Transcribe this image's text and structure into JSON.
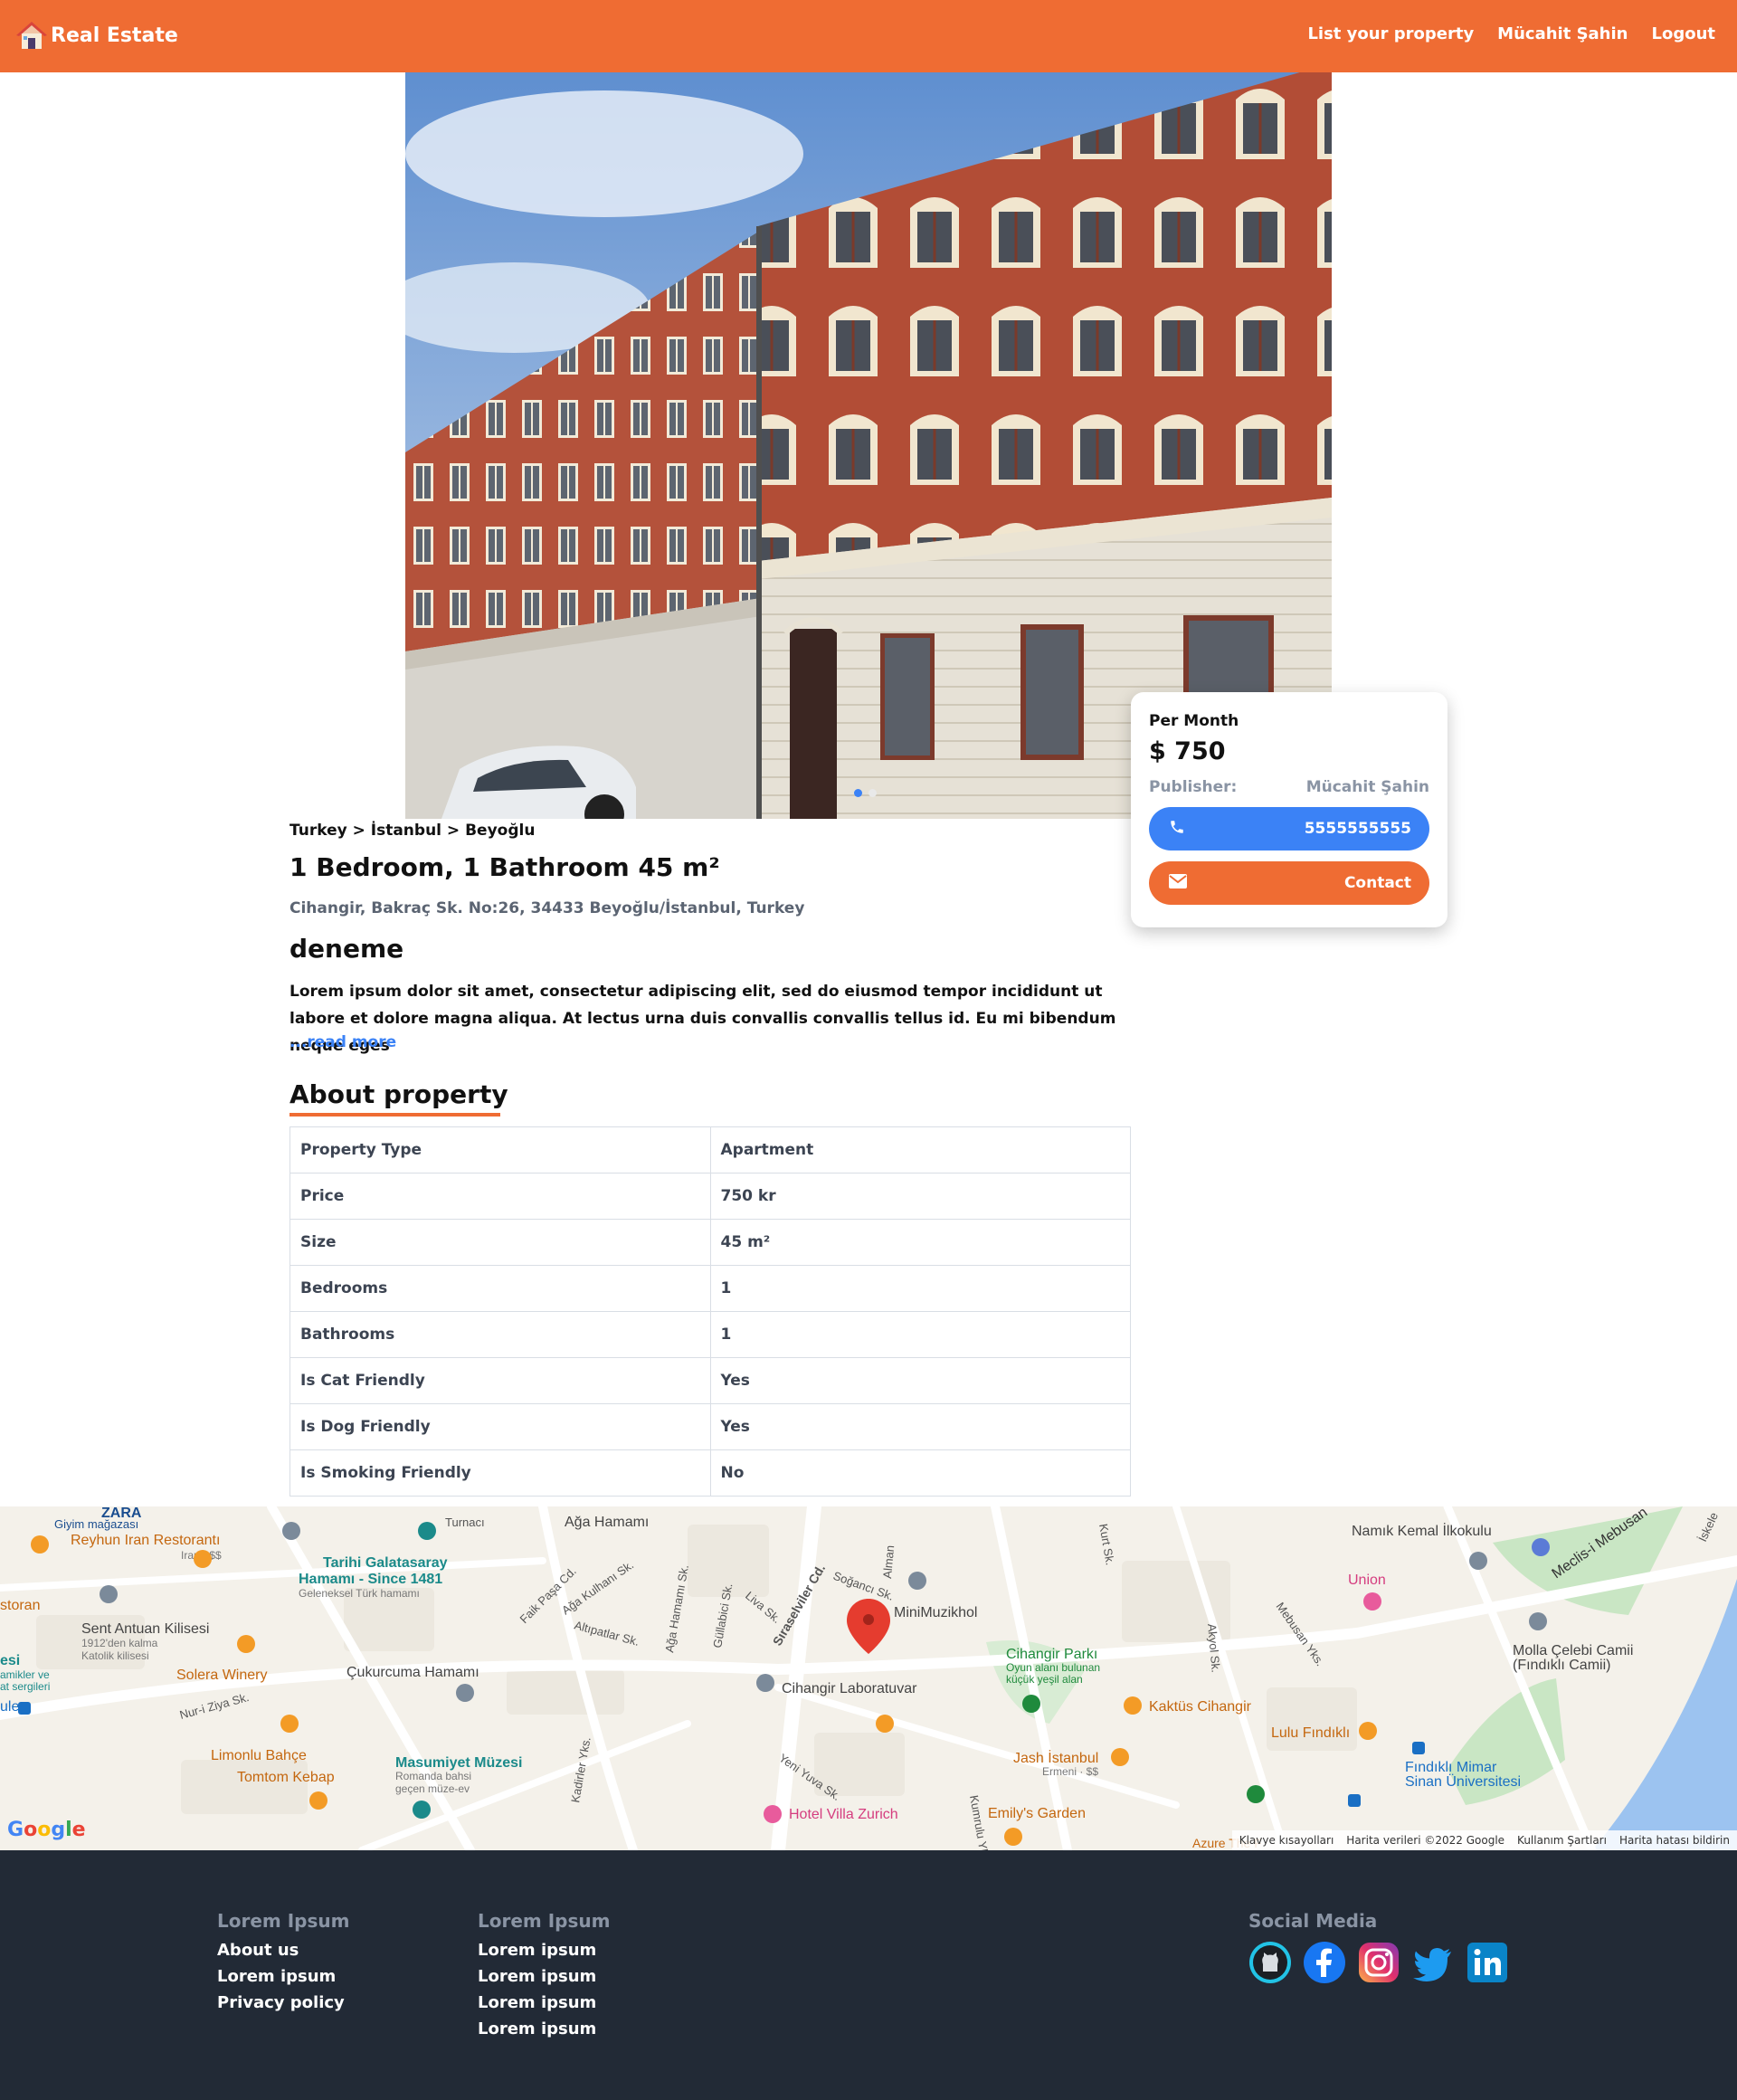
{
  "nav": {
    "brand": "Real Estate",
    "links": [
      "List your property",
      "Mücahit Şahin",
      "Logout"
    ]
  },
  "card": {
    "per_month": "Per Month",
    "price": "$ 750",
    "publisher_label": "Publisher:",
    "publisher_name": "Mücahit Şahin",
    "phone": "5555555555",
    "contact": "Contact"
  },
  "listing": {
    "breadcrumb": "Turkey > İstanbul > Beyoğlu",
    "title": "1 Bedroom, 1 Bathroom 45 m²",
    "address": "Cihangir, Bakraç Sk. No:26, 34433 Beyoğlu/İstanbul, Turkey",
    "subtitle": "deneme",
    "description": "Lorem ipsum dolor sit amet, consectetur adipiscing elit, sed do eiusmod tempor incididunt ut labore et dolore magna aliqua. At lectus urna duis convallis convallis tellus id. Eu mi bibendum neque eges",
    "read_more": "...read more",
    "about_heading": "About property"
  },
  "properties": [
    {
      "label": "Property Type",
      "value": "Apartment"
    },
    {
      "label": "Price",
      "value": "750 kr"
    },
    {
      "label": "Size",
      "value": "45 m²"
    },
    {
      "label": "Bedrooms",
      "value": "1"
    },
    {
      "label": "Bathrooms",
      "value": "1"
    },
    {
      "label": "Is Cat Friendly",
      "value": "Yes"
    },
    {
      "label": "Is Dog Friendly",
      "value": "Yes"
    },
    {
      "label": "Is Smoking Friendly",
      "value": "No"
    }
  ],
  "map": {
    "labels": {
      "zara": "ZARA",
      "giyim": "Giyim mağazası",
      "reyhun": "Reyhun Iran Restorantı",
      "reyhun_sub": "Iran · $$",
      "galatasaray": "Tarihi Galatasaray",
      "galatasaray2": "Hamamı - Since 1481",
      "galatasaray_sub": "Geleneksel Türk hamamı",
      "aga": "Ağa Hamamı",
      "namik": "Namık Kemal İlkokulu",
      "meclis": "Meclis-i Mebusan",
      "union": "Union",
      "sent": "Sent Antuan Kilisesi",
      "sent_sub1": "1912'den kalma",
      "sent_sub2": "Katolik kilisesi",
      "solera": "Solera Winery",
      "cukurcuma": "Çukurcuma Hamamı",
      "minimuzik": "MiniMuzikhol",
      "cihangir_lab": "Cihangir Laboratuvar",
      "cihangir_park": "Cihangir Parkı",
      "park_sub1": "Oyun alanı bulunan",
      "park_sub2": "küçük yeşil alan",
      "kaktus": "Kaktüs Cihangir",
      "molla": "Molla Çelebi Camii",
      "molla_sub": "(Fındıklı Camii)",
      "lulu": "Lulu Fındıklı",
      "limonlu": "Limonlu Bahçe",
      "tomtom": "Tomtom Kebap",
      "masumiyet": "Masumiyet Müzesi",
      "mas_sub1": "Romanda bahsi",
      "mas_sub2": "geçen müze-ev",
      "jash": "Jash İstanbul",
      "jash_sub": "Ermeni · $$",
      "findikli": "Fındıklı Mimar",
      "findikli2": "Sinan Üniversitesi",
      "hotel": "Hotel Villa Zurich",
      "emily": "Emily's Garden",
      "azure": "Azure The F",
      "storan": "storan",
      "esi": "esi",
      "amikler": "amikler ve",
      "sergileri": "at sergileri",
      "ule": "ule",
      "s_turnac": "Turnacı",
      "s_faik": "Faik Paşa Cd.",
      "s_aga_kul": "Ağa Kulhanı Sk.",
      "s_aga_ham": "Ağa Hamamı Sk.",
      "s_gullabici": "Güllabici Sk.",
      "s_liva": "Liva Sk.",
      "s_siraselviler": "Sıraselviler Cd.",
      "s_soganci": "Soğancı Sk.",
      "s_alman": "Alman",
      "s_altipatlar": "Altıpatlar Sk.",
      "s_nuri": "Nur-i Ziya Sk.",
      "s_yeni_yuva": "Yeni Yuva Sk.",
      "s_kumrulu": "Kumrulu Yks.",
      "s_akyol": "Akyol Sk.",
      "s_mebusan": "Mebusan Yks.",
      "s_kadirler": "Kadirler Yks.",
      "s_iskele": "İskele",
      "s_kurt": "Kurt Sk."
    },
    "google": "Google",
    "footer_links": [
      "Klavye kısayolları",
      "Harita verileri ©2022 Google",
      "Kullanım Şartları",
      "Harita hatası bildirin"
    ]
  },
  "footer": {
    "col1": {
      "heading": "Lorem Ipsum",
      "links": [
        "About us",
        "Lorem ipsum",
        "Privacy policy"
      ]
    },
    "col2": {
      "heading": "Lorem Ipsum",
      "links": [
        "Lorem ipsum",
        "Lorem ipsum",
        "Lorem ipsum",
        "Lorem ipsum"
      ]
    },
    "social": {
      "heading": "Social Media",
      "icons": [
        "github-icon",
        "facebook-icon",
        "instagram-icon",
        "twitter-icon",
        "linkedin-icon"
      ]
    }
  },
  "colors": {
    "brand": "#ef6c33",
    "phone_button": "#3b82f6",
    "footer_bg": "#222a36"
  }
}
